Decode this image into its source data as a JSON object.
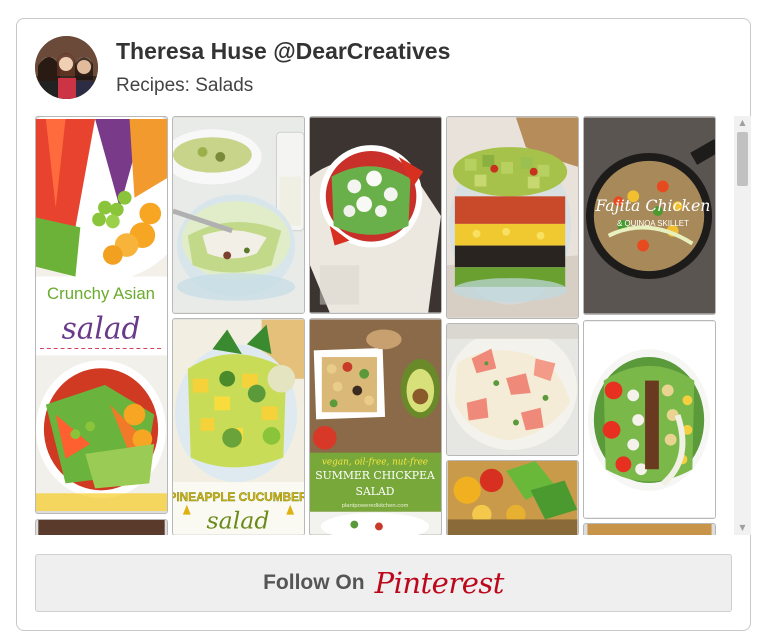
{
  "profile": {
    "owner": "Theresa Huse @DearCreatives",
    "board": "Recipes: Salads",
    "avatar_icon": "avatar-photo-icon"
  },
  "pins": [
    {
      "name": "pin-crunchy-asian-salad",
      "title": "Crunchy Asian",
      "subtitle": "salad",
      "icon": "salad-photo-icon"
    },
    {
      "name": "pin-cabbage-slaw-bowl",
      "icon": "salad-photo-icon"
    },
    {
      "name": "pin-pineapple-cucumber-salad",
      "title": "PINEAPPLE CUCUMBER",
      "subtitle": "salad",
      "icon": "salad-photo-icon"
    },
    {
      "name": "pin-feta-tomato-salad",
      "icon": "salad-photo-icon"
    },
    {
      "name": "pin-summer-chickpea-salad",
      "tagline": "vegan, oil-free, nut-free",
      "title": "SUMMER CHICKPEA",
      "subtitle": "SALAD",
      "site": "plantpoweredkitchen.com",
      "icon": "salad-photo-icon"
    },
    {
      "name": "pin-layered-avocado-salad",
      "icon": "salad-photo-icon"
    },
    {
      "name": "pin-crab-pasta-salad",
      "icon": "salad-photo-icon"
    },
    {
      "name": "pin-pasta-herb-salad",
      "icon": "salad-photo-icon"
    },
    {
      "name": "pin-fajita-chicken-quinoa-skillet",
      "title": "Fajita Chicken",
      "subtitle": "& QUINOA SKILLET",
      "icon": "skillet-photo-icon"
    },
    {
      "name": "pin-cobb-salad",
      "icon": "salad-photo-icon"
    }
  ],
  "follow": {
    "label": "Follow On",
    "brand": "Pinterest",
    "brand_color": "#bd081c"
  },
  "scrollbar": {
    "up_icon": "scroll-up-icon",
    "down_icon": "scroll-down-icon"
  }
}
